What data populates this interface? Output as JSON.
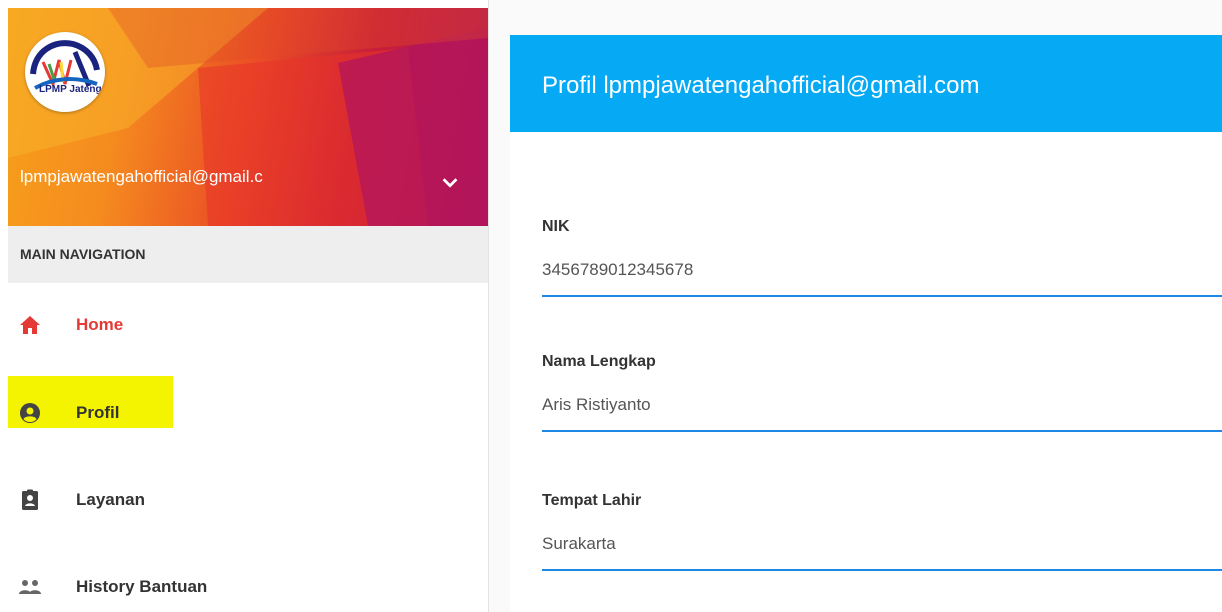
{
  "sidebar": {
    "user_email": "lpmpjawatengahofficial@gmail.c",
    "logo_text": "LPMP Jateng",
    "nav_header": "MAIN NAVIGATION",
    "items": [
      {
        "label": "Home",
        "icon": "home-icon",
        "active": true
      },
      {
        "label": "Profil",
        "icon": "account-circle-icon",
        "highlighted": true
      },
      {
        "label": "Layanan",
        "icon": "clipboard-account-icon"
      },
      {
        "label": "History Bantuan",
        "icon": "people-icon"
      }
    ]
  },
  "main": {
    "title": "Profil lpmpjawatengahofficial@gmail.com",
    "fields": [
      {
        "label": "NIK",
        "value": "3456789012345678"
      },
      {
        "label": "Nama Lengkap",
        "value": "Aris Ristiyanto"
      },
      {
        "label": "Tempat Lahir",
        "value": "Surakarta"
      }
    ]
  },
  "colors": {
    "header_blue": "#06a9f4",
    "active_red": "#e53935",
    "underline_blue": "#1e88e5",
    "highlight_yellow": "#f4f400"
  }
}
